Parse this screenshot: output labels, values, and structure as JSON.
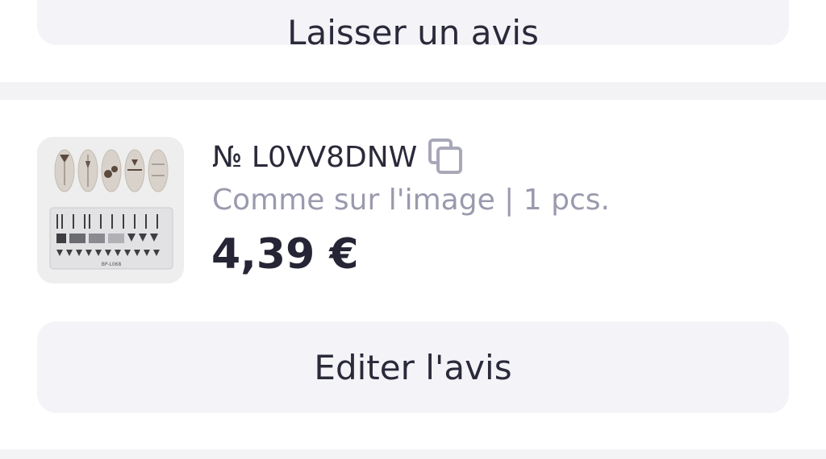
{
  "top_button": {
    "label": "Laisser un avis"
  },
  "order": {
    "number": "№ L0VV8DNW",
    "variant": "Comme sur l'image | 1 pcs.",
    "price": "4,39 €",
    "thumbnail": {
      "caption": "BP-L068"
    }
  },
  "edit_button": {
    "label": "Editer l'avis"
  },
  "colors": {
    "button_bg": "#f4f4f8",
    "divider": "#f3f3f6",
    "text_primary": "#2a2a3a",
    "text_secondary": "#9a9aae",
    "copy_icon": "#a8a8b8"
  },
  "icons": {
    "copy": "copy-icon"
  }
}
